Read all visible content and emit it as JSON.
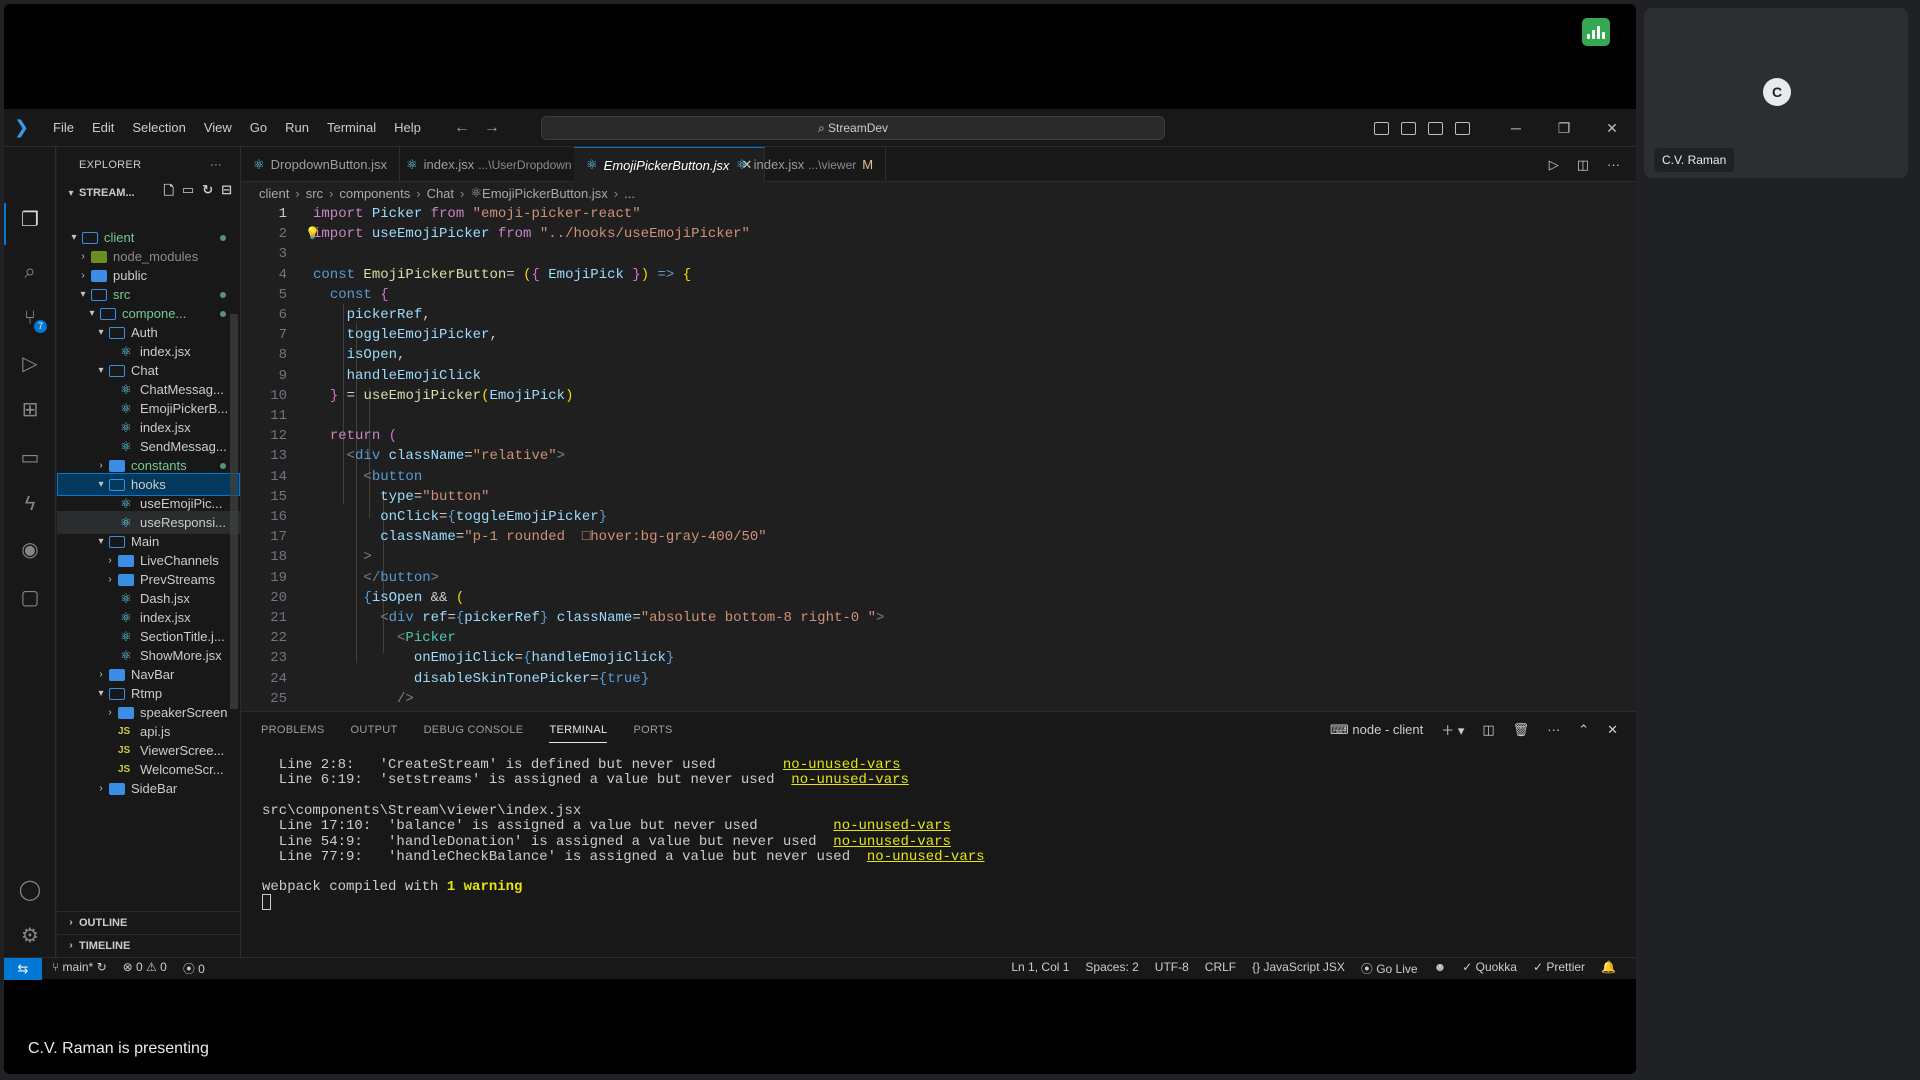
{
  "meet": {
    "presenting_text": "C.V. Raman is presenting",
    "participant_initial": "C",
    "participant_name": "C.V. Raman"
  },
  "titlebar": {
    "menu": [
      "File",
      "Edit",
      "Selection",
      "View",
      "Go",
      "Run",
      "Terminal",
      "Help"
    ],
    "search": "StreamDev"
  },
  "explorer": {
    "title": "EXPLORER",
    "root": "STREAM...",
    "outline": "OUTLINE",
    "timeline": "TIMELINE",
    "tree": [
      {
        "label": "client",
        "kind": "folder-open",
        "level": 1,
        "twisty": "v",
        "dot": true,
        "green": true
      },
      {
        "label": "node_modules",
        "kind": "nodem",
        "level": 2,
        "twisty": ">",
        "dim": true
      },
      {
        "label": "public",
        "kind": "folder",
        "level": 2,
        "twisty": ">"
      },
      {
        "label": "src",
        "kind": "folder-open",
        "level": 2,
        "twisty": "v",
        "dot": true,
        "green": true
      },
      {
        "label": "compone...",
        "kind": "folder-open",
        "level": 3,
        "twisty": "v",
        "dot": true,
        "green": true
      },
      {
        "label": "Auth",
        "kind": "folder-open",
        "level": 4,
        "twisty": "v"
      },
      {
        "label": "index.jsx",
        "kind": "react",
        "level": 5
      },
      {
        "label": "Chat",
        "kind": "folder-open",
        "level": 4,
        "twisty": "v"
      },
      {
        "label": "ChatMessag...",
        "kind": "react",
        "level": 5
      },
      {
        "label": "EmojiPickerB...",
        "kind": "react",
        "level": 5
      },
      {
        "label": "index.jsx",
        "kind": "react",
        "level": 5
      },
      {
        "label": "SendMessag...",
        "kind": "react",
        "level": 5
      },
      {
        "label": "constants",
        "kind": "folder",
        "level": 4,
        "twisty": ">",
        "dot": true,
        "green": true
      },
      {
        "label": "hooks",
        "kind": "folder-open",
        "level": 4,
        "twisty": "v",
        "selected": true
      },
      {
        "label": "useEmojiPic...",
        "kind": "react",
        "level": 5
      },
      {
        "label": "useResponsi...",
        "kind": "react",
        "level": 5,
        "hover": true
      },
      {
        "label": "Main",
        "kind": "folder-open",
        "level": 4,
        "twisty": "v"
      },
      {
        "label": "LiveChannels",
        "kind": "folder",
        "level": 5,
        "twisty": ">"
      },
      {
        "label": "PrevStreams",
        "kind": "folder",
        "level": 5,
        "twisty": ">"
      },
      {
        "label": "Dash.jsx",
        "kind": "react",
        "level": 5
      },
      {
        "label": "index.jsx",
        "kind": "react",
        "level": 5
      },
      {
        "label": "SectionTitle.j...",
        "kind": "react",
        "level": 5
      },
      {
        "label": "ShowMore.jsx",
        "kind": "react",
        "level": 5
      },
      {
        "label": "NavBar",
        "kind": "folder",
        "level": 4,
        "twisty": ">"
      },
      {
        "label": "Rtmp",
        "kind": "folder-open",
        "level": 4,
        "twisty": "v"
      },
      {
        "label": "speakerScreen",
        "kind": "folder",
        "level": 5,
        "twisty": ">"
      },
      {
        "label": "api.js",
        "kind": "js",
        "level": 5
      },
      {
        "label": "ViewerScree...",
        "kind": "js",
        "level": 5
      },
      {
        "label": "WelcomeScr...",
        "kind": "js",
        "level": 5
      },
      {
        "label": "SideBar",
        "kind": "folder",
        "level": 4,
        "twisty": ">"
      }
    ]
  },
  "tabs": [
    {
      "name": "DropdownButton.jsx",
      "desc": "",
      "active": false
    },
    {
      "name": "index.jsx",
      "desc": "...\\UserDropdown",
      "active": false
    },
    {
      "name": "EmojiPickerButton.jsx",
      "desc": "",
      "active": true
    },
    {
      "name": "index.jsx",
      "desc": "...\\viewer",
      "active": false,
      "modified": "M"
    }
  ],
  "breadcrumbs": [
    "client",
    "src",
    "components",
    "Chat",
    "EmojiPickerButton.jsx",
    "..."
  ],
  "code_lines": [
    [
      [
        "kw2",
        "import "
      ],
      [
        "var",
        "Picker "
      ],
      [
        "kw2",
        "from "
      ],
      [
        "str",
        "\"emoji-picker-react\""
      ]
    ],
    [
      [
        "kw2",
        "import "
      ],
      [
        "var",
        "useEmojiPicker "
      ],
      [
        "kw2",
        "from "
      ],
      [
        "str",
        "\"../hooks/useEmojiPicker\""
      ]
    ],
    [],
    [
      [
        "kw",
        "const "
      ],
      [
        "fn",
        "EmojiPickerButton"
      ],
      [
        "",
        "= "
      ],
      [
        "brk",
        "("
      ],
      [
        "punc",
        "{ "
      ],
      [
        "var",
        "EmojiPick "
      ],
      [
        "punc",
        "}"
      ],
      [
        "brk",
        ")"
      ],
      [
        "kw",
        " => "
      ],
      [
        "brk",
        "{"
      ]
    ],
    [
      [
        "",
        "  "
      ],
      [
        "kw",
        "const "
      ],
      [
        "punc",
        "{"
      ]
    ],
    [
      [
        "",
        "    "
      ],
      [
        "var",
        "pickerRef"
      ],
      [
        "",
        ","
      ]
    ],
    [
      [
        "",
        "    "
      ],
      [
        "var",
        "toggleEmojiPicker"
      ],
      [
        "",
        ","
      ]
    ],
    [
      [
        "",
        "    "
      ],
      [
        "var",
        "isOpen"
      ],
      [
        "",
        ","
      ]
    ],
    [
      [
        "",
        "    "
      ],
      [
        "var",
        "handleEmojiClick"
      ]
    ],
    [
      [
        "",
        "  "
      ],
      [
        "punc",
        "} "
      ],
      [
        "",
        "= "
      ],
      [
        "fn",
        "useEmojiPicker"
      ],
      [
        "brk",
        "("
      ],
      [
        "var",
        "EmojiPick"
      ],
      [
        "brk",
        ")"
      ]
    ],
    [],
    [
      [
        "",
        "  "
      ],
      [
        "kw2",
        "return "
      ],
      [
        "punc",
        "("
      ]
    ],
    [
      [
        "",
        "    "
      ],
      [
        "ph",
        "<"
      ],
      [
        "kw",
        "div "
      ],
      [
        "var",
        "className"
      ],
      [
        "",
        "="
      ],
      [
        "str",
        "\"relative\""
      ],
      [
        "ph",
        ">"
      ]
    ],
    [
      [
        "",
        "      "
      ],
      [
        "ph",
        "<"
      ],
      [
        "kw",
        "button"
      ]
    ],
    [
      [
        "",
        "        "
      ],
      [
        "var",
        "type"
      ],
      [
        "",
        "="
      ],
      [
        "str",
        "\"button\""
      ]
    ],
    [
      [
        "",
        "        "
      ],
      [
        "var",
        "onClick"
      ],
      [
        "",
        "="
      ],
      [
        "kw",
        "{"
      ],
      [
        "var",
        "toggleEmojiPicker"
      ],
      [
        "kw",
        "}"
      ]
    ],
    [
      [
        "",
        "        "
      ],
      [
        "var",
        "className"
      ],
      [
        "",
        "="
      ],
      [
        "str",
        "\"p-1 rounded  □hover:bg-gray-400/50\""
      ]
    ],
    [
      [
        "",
        "      "
      ],
      [
        "ph",
        ">"
      ]
    ],
    [
      [
        "",
        "      "
      ],
      [
        "ph",
        "</"
      ],
      [
        "kw",
        "button"
      ],
      [
        "ph",
        ">"
      ]
    ],
    [
      [
        "",
        "      "
      ],
      [
        "kw",
        "{"
      ],
      [
        "var",
        "isOpen "
      ],
      [
        "",
        "&& "
      ],
      [
        "brk",
        "("
      ]
    ],
    [
      [
        "",
        "        "
      ],
      [
        "ph",
        "<"
      ],
      [
        "kw",
        "div "
      ],
      [
        "var",
        "ref"
      ],
      [
        "",
        "="
      ],
      [
        "kw",
        "{"
      ],
      [
        "var",
        "pickerRef"
      ],
      [
        "kw",
        "} "
      ],
      [
        "var",
        "className"
      ],
      [
        "",
        "="
      ],
      [
        "str",
        "\"absolute bottom-8 right-0 \""
      ],
      [
        "ph",
        ">"
      ]
    ],
    [
      [
        "",
        "          "
      ],
      [
        "ph",
        "<"
      ],
      [
        "tag",
        "Picker"
      ]
    ],
    [
      [
        "",
        "            "
      ],
      [
        "var",
        "onEmojiClick"
      ],
      [
        "",
        "="
      ],
      [
        "kw",
        "{"
      ],
      [
        "var",
        "handleEmojiClick"
      ],
      [
        "kw",
        "}"
      ]
    ],
    [
      [
        "",
        "            "
      ],
      [
        "var",
        "disableSkinTonePicker"
      ],
      [
        "",
        "="
      ],
      [
        "kw",
        "{"
      ],
      [
        "kw",
        "true"
      ],
      [
        "kw",
        "}"
      ]
    ],
    [
      [
        "",
        "          "
      ],
      [
        "ph",
        "/>"
      ]
    ]
  ],
  "panel": {
    "tabs": [
      "PROBLEMS",
      "OUTPUT",
      "DEBUG CONSOLE",
      "TERMINAL",
      "PORTS"
    ],
    "active_tab": "TERMINAL",
    "terminal_name": "node - client",
    "lines": [
      {
        "prefix": "  Line 2:8:   'CreateStream' is defined but never used        ",
        "rule": "no-unused-vars"
      },
      {
        "prefix": "  Line 6:19:  'setstreams' is assigned a value but never used  ",
        "rule": "no-unused-vars"
      },
      {
        "prefix": "",
        "rule": ""
      },
      {
        "prefix": "src\\components\\Stream\\viewer\\index.jsx",
        "rule": ""
      },
      {
        "prefix": "  Line 17:10:  'balance' is assigned a value but never used         ",
        "rule": "no-unused-vars"
      },
      {
        "prefix": "  Line 54:9:   'handleDonation' is assigned a value but never used  ",
        "rule": "no-unused-vars"
      },
      {
        "prefix": "  Line 77:9:   'handleCheckBalance' is assigned a value but never used  ",
        "rule": "no-unused-vars"
      },
      {
        "prefix": "",
        "rule": ""
      },
      {
        "prefix": "webpack compiled with ",
        "bold": "1 warning"
      }
    ]
  },
  "status": {
    "branch": "main*",
    "errors": "0",
    "warnings": "0",
    "ports": "0",
    "position": "Ln 1, Col 1",
    "spaces": "Spaces: 2",
    "encoding": "UTF-8",
    "eol": "CRLF",
    "language": "JavaScript JSX",
    "golive": "Go Live",
    "quokka": "Quokka",
    "prettier": "Prettier"
  }
}
